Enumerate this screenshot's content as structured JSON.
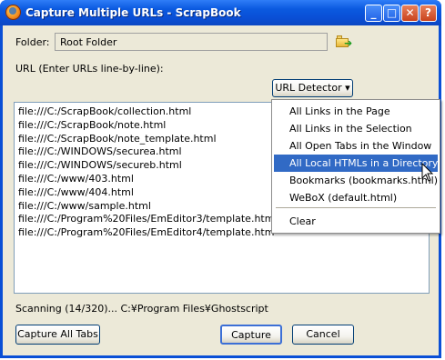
{
  "window": {
    "title": "Capture Multiple URLs - ScrapBook",
    "controls": {
      "minimize": "_",
      "maximize": "□",
      "close": "✕",
      "help": "?"
    }
  },
  "folder": {
    "label": "Folder:",
    "value": "Root Folder"
  },
  "url_section": {
    "label": "URL (Enter URLs line-by-line):"
  },
  "detector_button": {
    "label": "URL Detector ▾"
  },
  "urls": [
    "file:///C:/ScrapBook/collection.html",
    "file:///C:/ScrapBook/note.html",
    "file:///C:/ScrapBook/note_template.html",
    "file:///C:/WINDOWS/securea.html",
    "file:///C:/WINDOWS/secureb.html",
    "file:///C:/www/403.html",
    "file:///C:/www/404.html",
    "file:///C:/www/sample.html",
    "file:///C:/Program%20Files/EmEditor3/template.htm",
    "file:///C:/Program%20Files/EmEditor4/template.htm"
  ],
  "menu": {
    "items": [
      "All Links in the Page",
      "All Links in the Selection",
      "All Open Tabs in the Window",
      "All Local HTMLs in a Directory",
      "Bookmarks (bookmarks.html)",
      "WeBoX (default.html)",
      "Clear"
    ],
    "highlighted": "All Local HTMLs in a Directory"
  },
  "status": "Scanning (14/320)... C:¥Program Files¥Ghostscript",
  "buttons": {
    "capture_all_tabs": "Capture All Tabs",
    "capture": "Capture",
    "cancel": "Cancel"
  },
  "colors": {
    "titlebar": "#0a4fd6",
    "dialog_bg": "#ece9d8",
    "menu_highlight": "#316ac5"
  }
}
